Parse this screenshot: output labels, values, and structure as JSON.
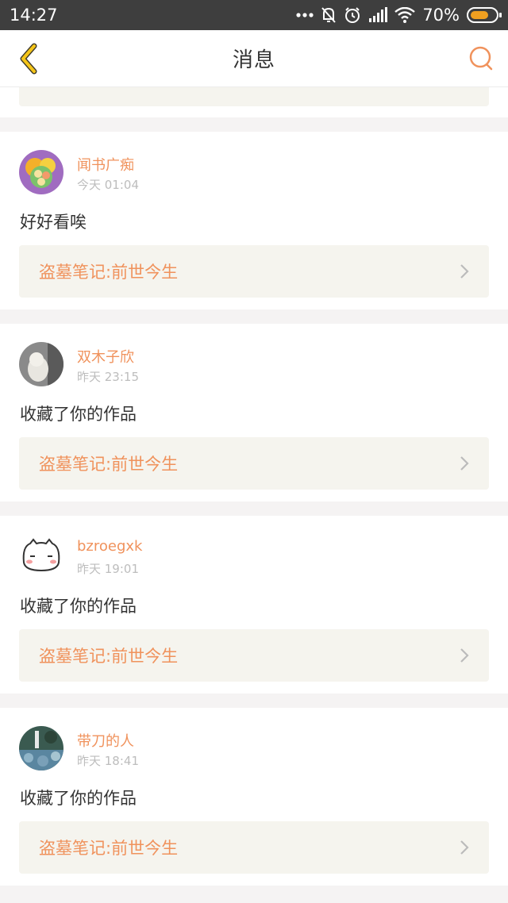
{
  "status_bar": {
    "time": "14:27",
    "battery_text": "70%"
  },
  "header": {
    "title": "消息"
  },
  "messages": [
    {
      "user": "闻书广痴",
      "time": "今天 01:04",
      "text": "好好看唉",
      "work": "盗墓笔记:前世今生"
    },
    {
      "user": "双木子欣",
      "time": "昨天 23:15",
      "text": "收藏了你的作品",
      "work": "盗墓笔记:前世今生"
    },
    {
      "user": "bzroegxk",
      "time": "昨天 19:01",
      "text": "收藏了你的作品",
      "work": "盗墓笔记:前世今生"
    },
    {
      "user": "带刀的人",
      "time": "昨天 18:41",
      "text": "收藏了你的作品",
      "work": "盗墓笔记:前世今生"
    }
  ],
  "colors": {
    "accent": "#f0925c",
    "back_icon": "#f5c518",
    "status_bar": "#3e3e3e",
    "work_bg": "#f5f4ee"
  }
}
